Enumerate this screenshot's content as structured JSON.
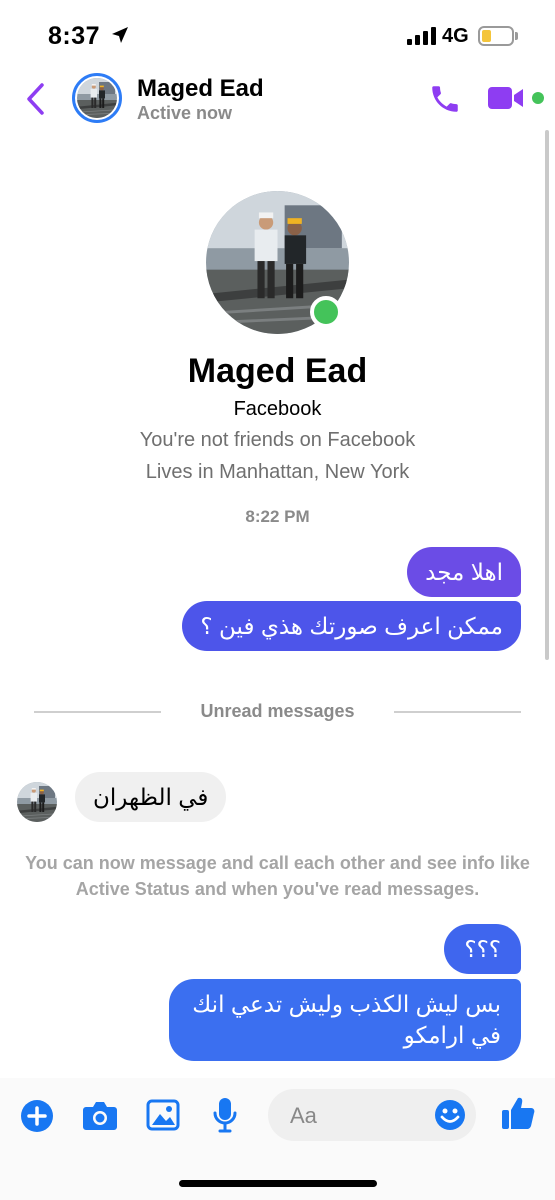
{
  "status_bar": {
    "time": "8:37",
    "network": "4G",
    "battery_level": 0.3
  },
  "header": {
    "name": "Maged Ead",
    "status": "Active now"
  },
  "profile": {
    "name": "Maged Ead",
    "source": "Facebook",
    "relationship": "You're not friends on Facebook",
    "location": "Lives in Manhattan, New York"
  },
  "thread": {
    "timestamp": "8:22 PM",
    "sent_1": "اهلا مجد",
    "sent_2": "ممكن اعرف صورتك هذي فين ؟",
    "unread_label": "Unread messages",
    "received_1": "في الظهران",
    "info": "You can now message and call each other and see info like Active Status and when you've read messages.",
    "sent_3": "؟؟؟",
    "sent_4": "بس ليش الكذب وليش تدعي انك في ارامكو"
  },
  "composer": {
    "placeholder": "Aa"
  },
  "colors": {
    "accent": "#8e3df2",
    "blue": "#1877f2",
    "active_green": "#44c35a"
  },
  "icons": [
    "location-arrow-icon",
    "signal-icon",
    "battery-icon",
    "back-chevron-icon",
    "phone-icon",
    "video-camera-icon",
    "plus-icon",
    "camera-icon",
    "gallery-icon",
    "microphone-icon",
    "emoji-icon",
    "thumbs-up-icon"
  ]
}
